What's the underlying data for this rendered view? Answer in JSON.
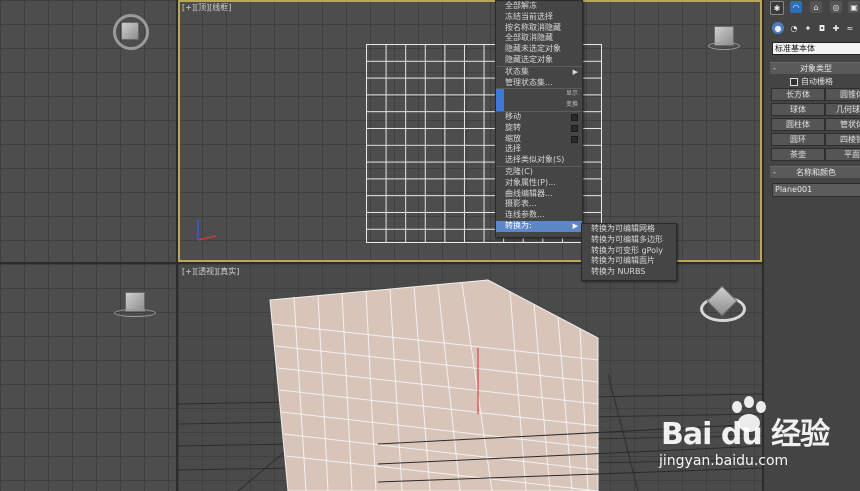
{
  "viewports": {
    "top": {
      "label": "[+][顶][线框]"
    },
    "perspective": {
      "label": "[+][透视][真实]"
    }
  },
  "quad_menu": {
    "items": [
      {
        "label": "全部解冻"
      },
      {
        "label": "冻结当前选择"
      },
      {
        "label": "按名称取消隐藏"
      },
      {
        "label": "全部取消隐藏"
      },
      {
        "label": "隐藏未选定对象"
      },
      {
        "label": "隐藏选定对象"
      },
      {
        "label": "状态集",
        "submenu": true
      },
      {
        "label": "管理状态集..."
      },
      {
        "label": "",
        "hint": "显示"
      },
      {
        "label": "",
        "hint": "变换"
      },
      {
        "label": "移动"
      },
      {
        "label": "旋转"
      },
      {
        "label": "缩放"
      },
      {
        "label": "选择"
      },
      {
        "label": "选择类似对象(S)"
      },
      {
        "label": "克隆(C)"
      },
      {
        "label": "对象属性(P)..."
      },
      {
        "label": "曲线编辑器..."
      },
      {
        "label": "摄影表..."
      },
      {
        "label": "连线参数..."
      },
      {
        "label": "转换为:",
        "submenu": true
      }
    ],
    "submenu": [
      {
        "label": "转换为可编辑网格"
      },
      {
        "label": "转换为可编辑多边形"
      },
      {
        "label": "转换为可变形 gPoly"
      },
      {
        "label": "转换为可编辑面片"
      },
      {
        "label": "转换为 NURBS"
      }
    ]
  },
  "command_panel": {
    "category": "标准基本体",
    "object_type_header": "对象类型",
    "auto_grid": "自动栅格",
    "object_buttons": [
      "长方体",
      "圆锥体",
      "球体",
      "几何球体",
      "圆柱体",
      "管状体",
      "圆环",
      "四棱锥",
      "茶壶",
      "平面"
    ],
    "name_color_header": "名称和颜色",
    "object_name": "Plane001"
  },
  "colors": {
    "viewport_bg": "#4d4d4d",
    "active_border": "#b9a75a",
    "menu_bg": "#454545",
    "menu_highlight": "#5d88c6",
    "plane_fill": "#d8c4b8"
  },
  "watermark": {
    "brand": "Bai du 经验",
    "url": "jingyan.baidu.com"
  }
}
